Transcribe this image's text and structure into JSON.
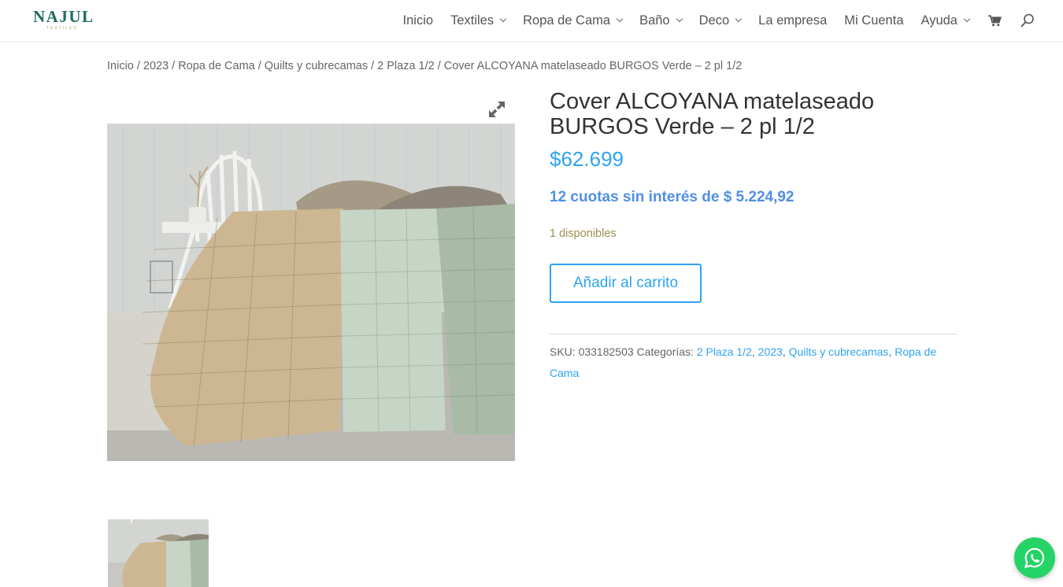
{
  "header": {
    "logo_text": "NAJUL",
    "logo_sub": "TEXTILES",
    "nav": [
      {
        "label": "Inicio",
        "dropdown": false
      },
      {
        "label": "Textiles",
        "dropdown": true
      },
      {
        "label": "Ropa de Cama",
        "dropdown": true
      },
      {
        "label": "Baño",
        "dropdown": true
      },
      {
        "label": "Deco",
        "dropdown": true
      },
      {
        "label": "La empresa",
        "dropdown": false
      },
      {
        "label": "Mi Cuenta",
        "dropdown": false
      },
      {
        "label": "Ayuda",
        "dropdown": true
      }
    ],
    "icons": [
      "cart-icon",
      "search-icon"
    ]
  },
  "breadcrumb": {
    "items": [
      "Inicio",
      "2023",
      "Ropa de Cama",
      "Quilts y cubrecamas",
      "2 Plaza 1/2"
    ],
    "current": "Cover ALCOYANA matelaseado BURGOS Verde – 2 pl 1/2",
    "separator": "/"
  },
  "product": {
    "title": "Cover ALCOYANA matelaseado BURGOS Verde – 2 pl 1/2",
    "price": "$62.699",
    "installments": "12 cuotas sin interés de $ 5.224,92",
    "stock": "1 disponibles",
    "add_to_cart_label": "Añadir al carrito",
    "sku_label": "SKU:",
    "sku": "033182503",
    "categories_label": "Categorías:",
    "categories": [
      "2 Plaza 1/2",
      "2023",
      "Quilts y cubrecamas",
      "Ropa de Cama"
    ]
  },
  "colors": {
    "accent": "#2ea3f2",
    "installments": "#4f8fe6",
    "stock": "#9b8f4f",
    "logo": "#1d6b62",
    "whatsapp": "#25d366"
  }
}
